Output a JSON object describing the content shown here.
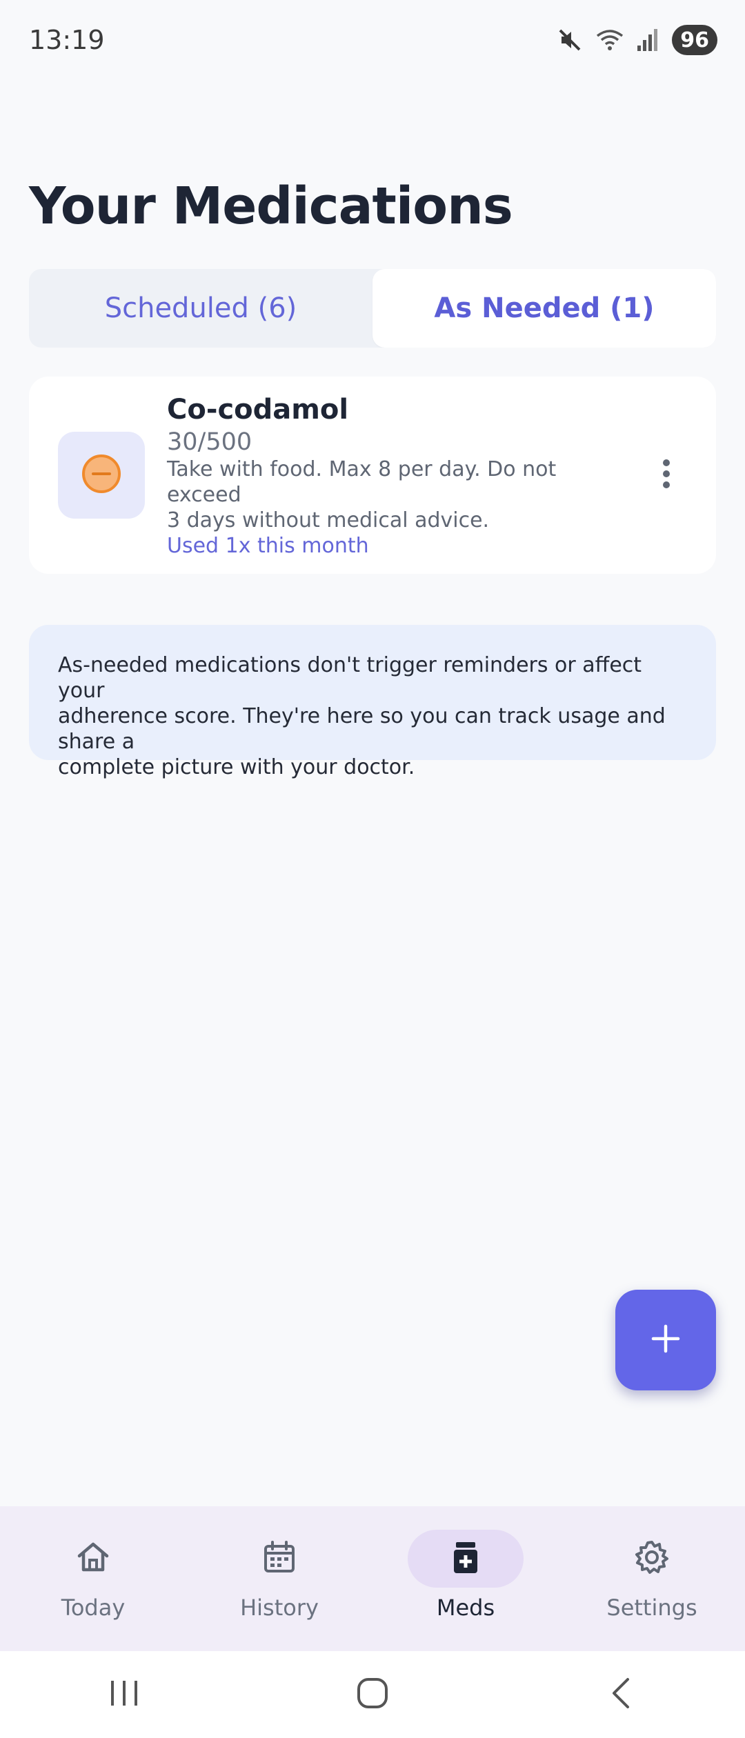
{
  "status_bar": {
    "time": "13:19",
    "battery": "96"
  },
  "page": {
    "title": "Your Medications"
  },
  "tabs": [
    {
      "label": "Scheduled (6)",
      "active": false
    },
    {
      "label": "As Needed (1)",
      "active": true
    }
  ],
  "medication": {
    "name": "Co-codamol",
    "dose": "30/500",
    "note_line1": "Take with food. Max 8 per day. Do not exceed",
    "note_line2": "3 days without medical advice.",
    "usage": "Used 1x this month",
    "icon": "pill-minus-icon",
    "icon_color": "#f08a2c"
  },
  "info": {
    "line1": "As-needed medications don't trigger reminders or affect your",
    "line2": "adherence score. They're here so you can track usage and share a",
    "line3": "complete picture with your doctor."
  },
  "fab": {
    "icon": "plus-icon",
    "color": "#6366e8"
  },
  "bottom_nav": [
    {
      "label": "Today",
      "icon": "home-icon",
      "active": false
    },
    {
      "label": "History",
      "icon": "calendar-icon",
      "active": false
    },
    {
      "label": "Meds",
      "icon": "medicine-bottle-icon",
      "active": true
    },
    {
      "label": "Settings",
      "icon": "gear-icon",
      "active": false
    }
  ],
  "colors": {
    "accent": "#6366d8",
    "background": "#f8f9fb",
    "nav_background": "#f1edf8"
  }
}
